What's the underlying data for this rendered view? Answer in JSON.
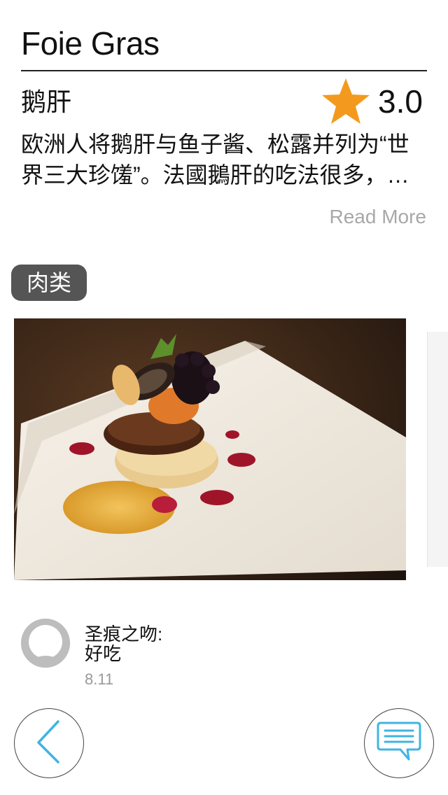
{
  "dish": {
    "name": "Foie Gras",
    "chinese_name": "鹅肝",
    "rating": "3.0",
    "description": "欧洲人将鹅肝与鱼子酱、松露并列为“世界三大珍馐”。法國鵝肝的吃法很多，可以煎、烤、做成鹅肝酱，搭配面包或水果享用。",
    "read_more_label": "Read More",
    "category_tag": "肉类"
  },
  "photos": {
    "current_icon": "plated-foie-gras-photo",
    "next_icon": "next-photo-peek"
  },
  "comments": [
    {
      "author": "圣痕之吻:",
      "text": "好吃",
      "date": "8.11",
      "avatar_icon": "default-avatar-icon"
    }
  ],
  "actions": {
    "back_icon": "back-chevron-icon",
    "comment_icon": "chat-bubble-icon"
  },
  "colors": {
    "star": "#F39A1E",
    "accent": "#3FB4E4",
    "tag_bg": "#555555",
    "muted_text": "#A8A8A8"
  }
}
